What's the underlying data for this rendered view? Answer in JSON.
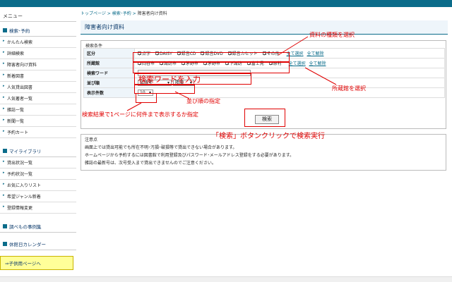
{
  "colors": {
    "accent": "#0b6c8a",
    "annotation": "#e00000",
    "yellow": "#ffff99"
  },
  "sidebar": {
    "title": "メニュー",
    "sections": [
      {
        "head": "検索･予約",
        "items": [
          "かんたん検索",
          "詳細検索",
          "障害者向け資料",
          "新着図書",
          "人気貸出図書",
          "人気著者一覧",
          "雑誌一覧",
          "新聞一覧",
          "予約カート"
        ]
      },
      {
        "head": "マイライブラリ",
        "items": [
          "貸出状況一覧",
          "予約状況一覧",
          "お気に入りリスト",
          "希望ジャンル新着",
          "登録情報変更"
        ]
      },
      {
        "head": "調べもの事例集",
        "items": []
      },
      {
        "head": "休館日カレンダー",
        "items": []
      }
    ],
    "kids_button": "⇒子供用ページへ"
  },
  "breadcrumb": {
    "top": "トップページ",
    "search": "検索･予約",
    "current": "障害者向け資料"
  },
  "page_title": "障害者向け資料",
  "search": {
    "box_title": "検索条件",
    "category": {
      "label": "区分",
      "options": [
        "点字",
        "DAISY",
        "録音CD",
        "録音DVD",
        "録音カセット",
        "その他"
      ]
    },
    "library": {
      "label": "所蔵館",
      "options": [
        "岡谷市",
        "諏訪市",
        "茅野市",
        "茅野市",
        "下諏訪",
        "富士見",
        "原村"
      ]
    },
    "select_all": "全て選択",
    "clear_all": "全て解除",
    "keyword": {
      "label": "検索ワード",
      "value": ""
    },
    "sort": {
      "label": "並び順",
      "field": "出版年",
      "order": "降順"
    },
    "count": {
      "label": "表示件数",
      "value": "10"
    },
    "button": "検索"
  },
  "notice": {
    "title": "注意点",
    "lines": [
      "画面上では貸出可能でも所在不明･汚損･破損等で貸出できない場合があります。",
      "ホームページから予約するには図書館で利用登録及びパスワード･メールアドレス登録をする必要があります。",
      "雑誌の最新号は、次号受入まで貸出できませんのでご注意ください。"
    ]
  },
  "annotations": {
    "type": "資料の種類を選択",
    "library": "所蔵館を選択",
    "keyword": "検索ワードを入力",
    "sort": "並び順の指定",
    "count": "検索結果で1ページに何件まで表示するか指定",
    "button": "「検索」ボタンクリックで検索実行"
  }
}
